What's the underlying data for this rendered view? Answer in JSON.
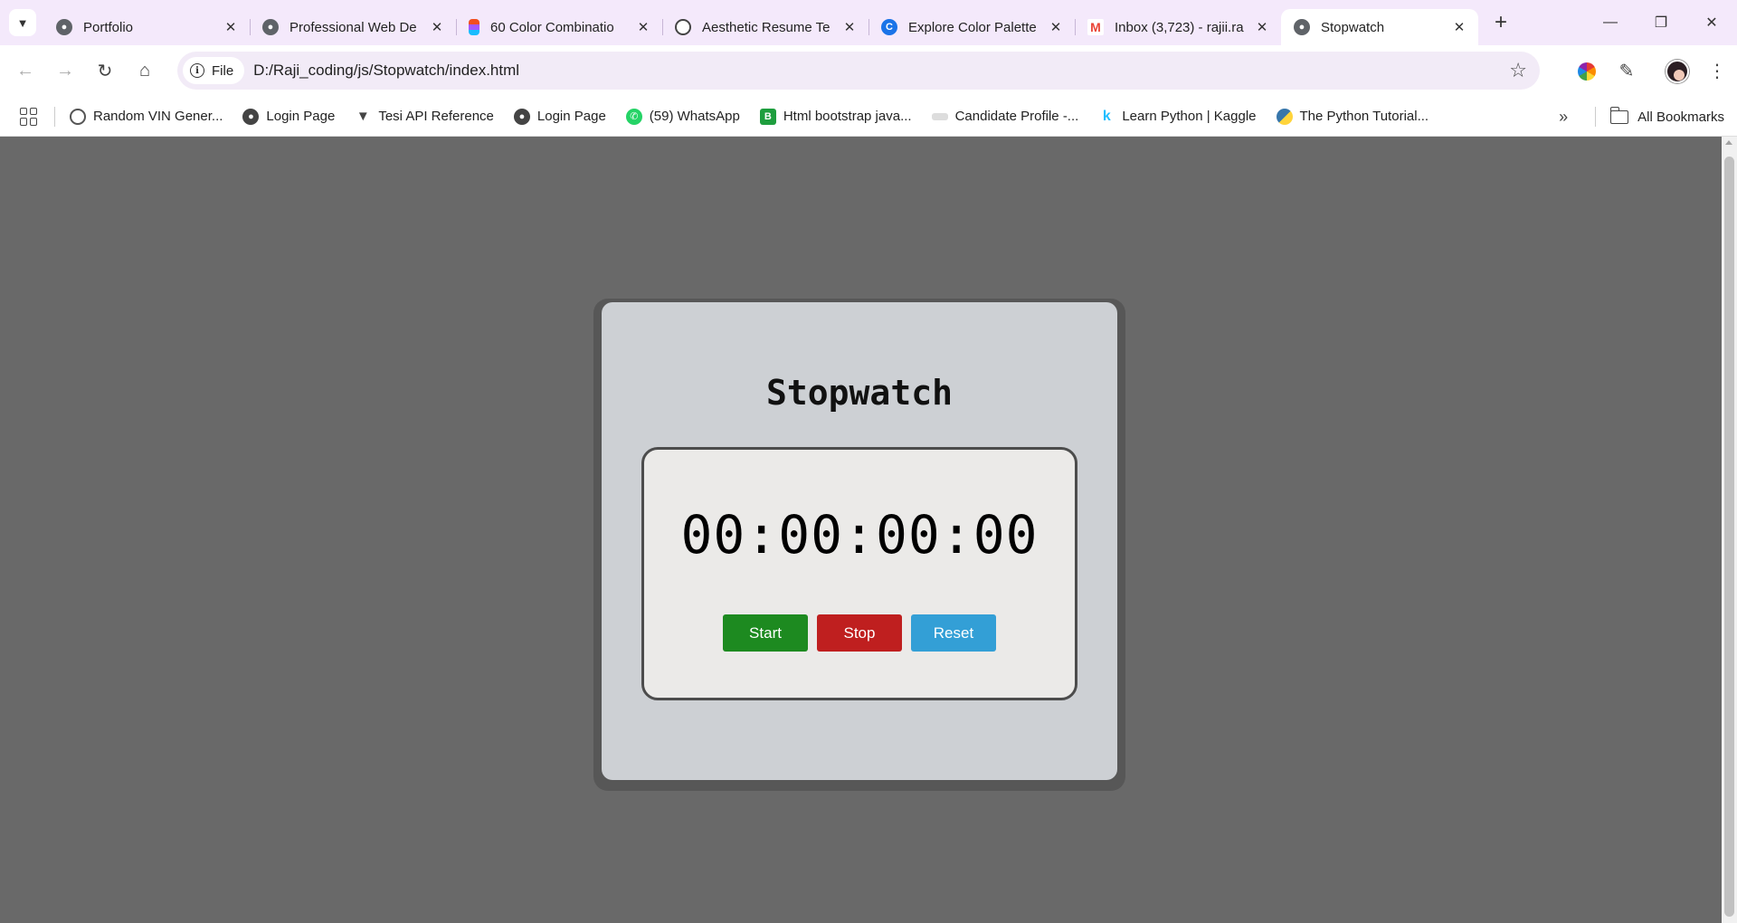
{
  "browser": {
    "tabs": [
      {
        "title": "Portfolio",
        "favicon": "globe-icon",
        "active": false
      },
      {
        "title": "Professional Web De",
        "favicon": "globe-icon",
        "active": false
      },
      {
        "title": "60 Color Combinatio",
        "favicon": "figma-icon",
        "active": false
      },
      {
        "title": "Aesthetic Resume Te",
        "favicon": "openai-icon",
        "active": false
      },
      {
        "title": "Explore Color Palette",
        "favicon": "canva-icon",
        "active": false
      },
      {
        "title": "Inbox (3,723) - rajii.ra",
        "favicon": "gmail-icon",
        "active": false
      },
      {
        "title": "Stopwatch",
        "favicon": "globe-icon",
        "active": true
      }
    ],
    "new_tab_symbol": "+",
    "address": {
      "chip_label": "File",
      "url": "D:/Raji_coding/js/Stopwatch/index.html"
    },
    "bookmarks": [
      {
        "label": "Random VIN Gener...",
        "icon": "loader-icon"
      },
      {
        "label": "Login Page",
        "icon": "globe-icon"
      },
      {
        "label": "Tesi API Reference",
        "icon": "tesi-icon"
      },
      {
        "label": "Login Page",
        "icon": "globe-icon"
      },
      {
        "label": "(59) WhatsApp",
        "icon": "whatsapp-icon"
      },
      {
        "label": "Html bootstrap java...",
        "icon": "bootstrap-icon"
      },
      {
        "label": "Candidate Profile -...",
        "icon": "profile-icon"
      },
      {
        "label": "Learn Python | Kaggle",
        "icon": "kaggle-icon"
      },
      {
        "label": "The Python Tutorial...",
        "icon": "python-icon"
      }
    ],
    "all_bookmarks_label": "All Bookmarks"
  },
  "page": {
    "heading": "Stopwatch",
    "time_display": "00:00:00:00",
    "buttons": {
      "start": "Start",
      "stop": "Stop",
      "reset": "Reset"
    }
  },
  "colors": {
    "page_background": "#696969",
    "start_button": "#1d8a20",
    "stop_button": "#bf1f1f",
    "reset_button": "#339fd6"
  }
}
